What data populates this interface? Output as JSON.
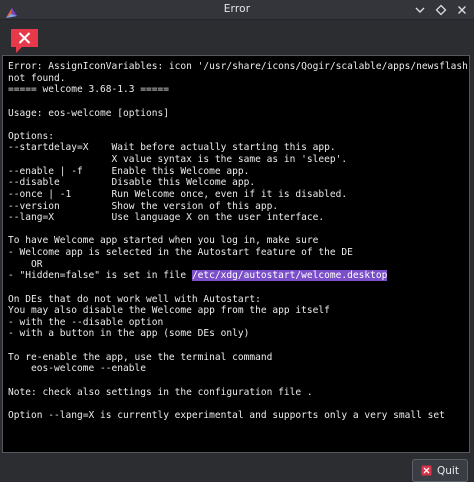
{
  "window": {
    "title": "Error"
  },
  "icons": {
    "app_logo": "endeavouros-logo-icon",
    "error": "error-message-icon",
    "quit": "quit-icon",
    "minimize": "chevron-down-icon",
    "maximize": "diamond-icon",
    "close": "close-icon"
  },
  "colors": {
    "highlight": "#7b4fc9",
    "error_icon": "#e8394a",
    "text_background": "#000000"
  },
  "message": {
    "lines": [
      {
        "text": "Error: AssignIconVariables: icon '/usr/share/icons/Qogir/scalable/apps/newsflash.svg'"
      },
      {
        "text": "not found."
      },
      {
        "text": "===== welcome 3.68-1.3 ====="
      },
      {
        "text": ""
      },
      {
        "text": "Usage: eos-welcome [options]"
      },
      {
        "text": ""
      },
      {
        "text": "Options:"
      },
      {
        "text": "--startdelay=X    Wait before actually starting this app."
      },
      {
        "text": "                  X value syntax is the same as in 'sleep'."
      },
      {
        "text": "--enable | -f     Enable this Welcome app."
      },
      {
        "text": "--disable         Disable this Welcome app."
      },
      {
        "text": "--once | -1       Run Welcome once, even if it is disabled."
      },
      {
        "text": "--version         Show the version of this app."
      },
      {
        "text": "--lang=X          Use language X on the user interface."
      },
      {
        "text": ""
      },
      {
        "text": "To have Welcome app started when you log in, make sure"
      },
      {
        "text": "- Welcome app is selected in the Autostart feature of the DE"
      },
      {
        "text": "    OR"
      },
      {
        "text": "- \"Hidden=false\" is set in file ",
        "highlight": "/etc/xdg/autostart/welcome.desktop"
      },
      {
        "text": ""
      },
      {
        "text": "On DEs that do not work well with Autostart:"
      },
      {
        "text": "You may also disable the Welcome app from the app itself"
      },
      {
        "text": "- with the --disable option"
      },
      {
        "text": "- with a button in the app (some DEs only)"
      },
      {
        "text": ""
      },
      {
        "text": "To re-enable the app, use the terminal command"
      },
      {
        "text": "    eos-welcome --enable"
      },
      {
        "text": ""
      },
      {
        "text": "Note: check also settings in the configuration file ."
      },
      {
        "text": ""
      },
      {
        "text": "Option --lang=X is currently experimental and supports only a very small set"
      }
    ]
  },
  "buttons": {
    "quit_label": "Quit"
  }
}
